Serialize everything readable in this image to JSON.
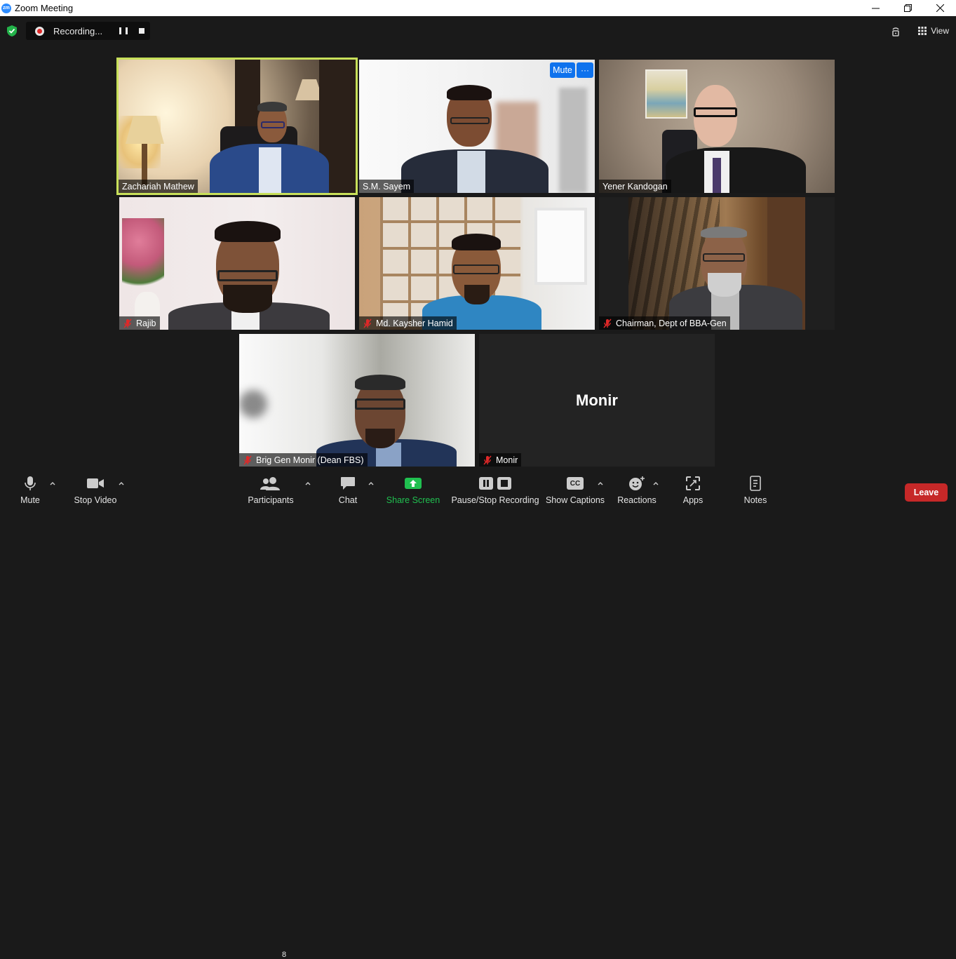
{
  "window": {
    "title": "Zoom Meeting",
    "logo_text": "zm"
  },
  "topbar": {
    "recording_label": "Recording...",
    "view_label": "View"
  },
  "participants": [
    {
      "name": "Zachariah Mathew",
      "muted": false,
      "active_speaker": true
    },
    {
      "name": "S.M. Sayem",
      "muted": false
    },
    {
      "name": "Yener Kandogan",
      "muted": false
    },
    {
      "name": "Rajib",
      "muted": true
    },
    {
      "name": "Md. Kaysher Hamid",
      "muted": true
    },
    {
      "name": "Chairman, Dept of BBA-Gen",
      "muted": true
    },
    {
      "name": "Brig Gen Monir (Dean FBS)",
      "muted": true
    },
    {
      "name": "Monir",
      "muted": true,
      "video_off": true
    }
  ],
  "hover_controls": {
    "mute_label": "Mute",
    "more_label": "···"
  },
  "toolbar": {
    "mute": "Mute",
    "stop_video": "Stop Video",
    "participants": "Participants",
    "participants_count": "8",
    "chat": "Chat",
    "share_screen": "Share Screen",
    "pause_stop_recording": "Pause/Stop Recording",
    "show_captions": "Show Captions",
    "captions_icon_text": "CC",
    "reactions": "Reactions",
    "apps": "Apps",
    "notes": "Notes",
    "leave": "Leave"
  },
  "colors": {
    "active_speaker_border": "#c8e05a",
    "share_green": "#20c050",
    "leave_red": "#c62828",
    "button_blue": "#0e72ed"
  }
}
